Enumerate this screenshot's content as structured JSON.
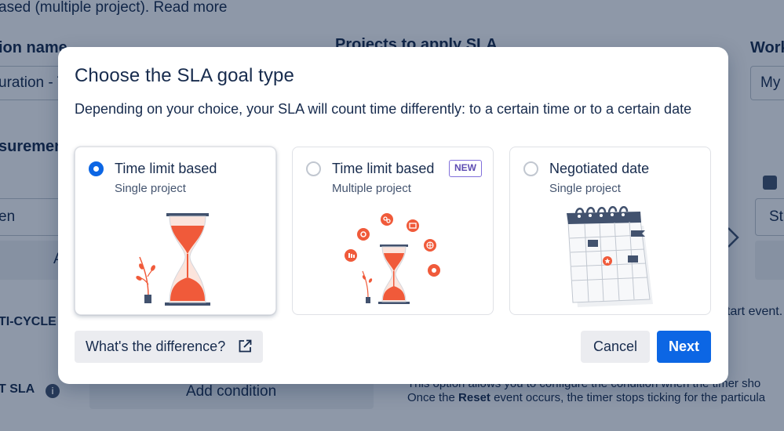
{
  "background": {
    "top_text": "ased (multiple project). Read more",
    "col_name_label": "ion name",
    "col_projects_label": "Projects to apply SLA",
    "col_work_label": "Work",
    "name_value": "uration - T",
    "work_value": "My",
    "measurement_label": "surement",
    "open_value": "en",
    "a_label": "A",
    "st_value": "St",
    "multicycle_label": "TI-CYCLE",
    "start_event_text": "tart event.",
    "reset_sla_label": "T SLA",
    "add_condition_label": "Add condition",
    "help_line1": "This option allows you to configure the condition when the timer sho",
    "help_line2_pre": "Once the ",
    "help_line2_bold": "Reset",
    "help_line2_post": " event occurs, the timer stops ticking for the particula"
  },
  "modal": {
    "title": "Choose the SLA goal type",
    "description": "Depending on your choice, your SLA will count time differently: to a certain time or to a certain date",
    "options": [
      {
        "title": "Time limit based",
        "subtitle": "Single project",
        "selected": true,
        "badge": ""
      },
      {
        "title": "Time limit based",
        "subtitle": "Multiple project",
        "selected": false,
        "badge": "NEW"
      },
      {
        "title": "Negotiated date",
        "subtitle": "Single project",
        "selected": false,
        "badge": ""
      }
    ],
    "difference_button": "What's the difference?",
    "cancel_button": "Cancel",
    "next_button": "Next"
  },
  "colors": {
    "accent": "#0c66e4",
    "illustration": "#f05a3a",
    "badge": "#5e4db2"
  }
}
